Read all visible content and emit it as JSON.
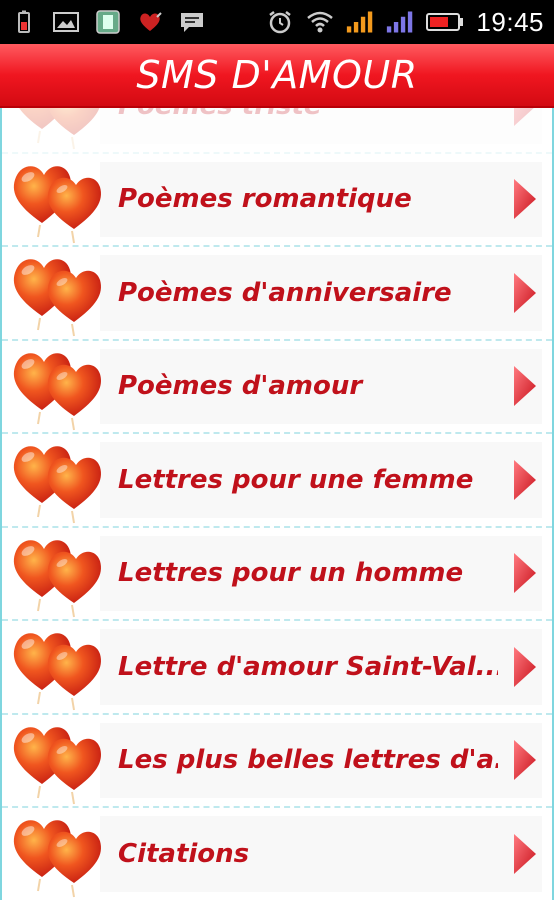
{
  "status_bar": {
    "time": "19:45",
    "icons": [
      "battery-saver-icon",
      "gallery-icon",
      "app-icon",
      "heart-notification-icon",
      "message-icon",
      "alarm-icon",
      "wifi-icon",
      "signal-icon",
      "signal-icon-2",
      "battery-icon"
    ]
  },
  "header": {
    "title": "SMS D'AMOUR"
  },
  "colors": {
    "header_red": "#f01620",
    "label_red": "#c0111b",
    "heart_orange": "#e8401a",
    "chevron_red": "#d8101a"
  },
  "menu": {
    "items": [
      {
        "label": "Poèmes triste",
        "icon": "double-heart-icon"
      },
      {
        "label": "Poèmes romantique",
        "icon": "double-heart-icon"
      },
      {
        "label": "Poèmes d'anniversaire",
        "icon": "double-heart-icon"
      },
      {
        "label": "Poèmes d'amour",
        "icon": "double-heart-icon"
      },
      {
        "label": "Lettres pour une femme",
        "icon": "double-heart-icon"
      },
      {
        "label": "Lettres pour un homme",
        "icon": "double-heart-icon"
      },
      {
        "label": "Lettre d'amour Saint-Val...",
        "icon": "double-heart-icon"
      },
      {
        "label": "Les plus belles lettres d'a...",
        "icon": "double-heart-icon"
      },
      {
        "label": "Citations",
        "icon": "double-heart-icon"
      }
    ]
  }
}
